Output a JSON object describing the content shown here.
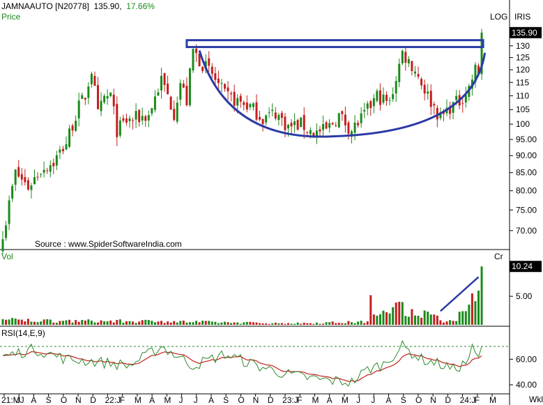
{
  "header": {
    "symbol": "JAMNAAUTO [N20778]",
    "price": "135.90",
    "change": "17.66%",
    "panel_label": "Price"
  },
  "top_right": {
    "log": "LOG",
    "iris": "IRIS"
  },
  "source": "Source : www.SpiderSoftwareIndia.com",
  "colors": {
    "up": "#1a8a1a",
    "down": "#c41e1e",
    "pattern": "#2b3aa6",
    "rsi": "#2a8a2a",
    "rsi_avg": "#c41e1e",
    "last_box": "#000000"
  },
  "price_panel": {
    "label": "Price",
    "last_value": "135.90",
    "scale": "log",
    "y_ticks": [
      "130",
      "125",
      "120",
      "115",
      "110",
      "105",
      "100",
      "95.00",
      "90.00",
      "85.00",
      "80.00",
      "75.00",
      "70.00"
    ]
  },
  "volume_panel": {
    "label": "Vol",
    "unit": "Cr",
    "last_value": "10.24",
    "y_ticks": [
      "5.00"
    ]
  },
  "rsi_panel": {
    "label": "RSI(14,E,9)",
    "y_ticks": [
      "60.00",
      "40.00"
    ]
  },
  "x_axis": {
    "labels": [
      "21:MJ",
      "J",
      "A",
      "S",
      "O",
      "N",
      "D",
      "22:J",
      "F",
      "M",
      "A",
      "M",
      "J",
      "J",
      "A",
      "S",
      "O",
      "N",
      "D",
      "23:J",
      "F",
      "M",
      "A",
      "M",
      "J",
      "J",
      "A",
      "S",
      "O",
      "N",
      "D",
      "24:J",
      "F",
      "M"
    ],
    "unit": "Wkl"
  },
  "chart_data": {
    "type": "candlestick",
    "interval": "weekly",
    "y_scale": "log",
    "close_anchors": [
      [
        0,
        68
      ],
      [
        4,
        85
      ],
      [
        8,
        81
      ],
      [
        12,
        86
      ],
      [
        16,
        88
      ],
      [
        20,
        94
      ],
      [
        24,
        106
      ],
      [
        26,
        110
      ],
      [
        28,
        120
      ],
      [
        30,
        103
      ],
      [
        32,
        109
      ],
      [
        34,
        110
      ],
      [
        36,
        98
      ],
      [
        39,
        101
      ],
      [
        42,
        102
      ],
      [
        46,
        103
      ],
      [
        50,
        116
      ],
      [
        54,
        104
      ],
      [
        56,
        115
      ],
      [
        58,
        108
      ],
      [
        60,
        128
      ],
      [
        62,
        124
      ],
      [
        66,
        118
      ],
      [
        70,
        110
      ],
      [
        74,
        108
      ],
      [
        78,
        106
      ],
      [
        82,
        102
      ],
      [
        86,
        104
      ],
      [
        90,
        99
      ],
      [
        94,
        100
      ],
      [
        98,
        97
      ],
      [
        102,
        98
      ],
      [
        106,
        103
      ],
      [
        110,
        98
      ],
      [
        114,
        103
      ],
      [
        118,
        110
      ],
      [
        122,
        107
      ],
      [
        126,
        127
      ],
      [
        130,
        120
      ],
      [
        134,
        110
      ],
      [
        138,
        102
      ],
      [
        141,
        106
      ],
      [
        144,
        108
      ],
      [
        147,
        113
      ],
      [
        149,
        120
      ],
      [
        150,
        119
      ],
      [
        151,
        135.9
      ]
    ],
    "volume_anchors": [
      [
        0,
        1.0
      ],
      [
        20,
        0.8
      ],
      [
        50,
        0.7
      ],
      [
        90,
        0.3
      ],
      [
        115,
        0.6
      ],
      [
        116,
        5.2
      ],
      [
        118,
        1.6
      ],
      [
        126,
        4.0
      ],
      [
        140,
        0.6
      ],
      [
        146,
        2.4
      ],
      [
        148,
        5.5
      ],
      [
        150,
        6.0
      ],
      [
        151,
        10.24
      ]
    ],
    "rsi_anchors": [
      [
        0,
        62
      ],
      [
        10,
        68
      ],
      [
        20,
        60
      ],
      [
        30,
        58
      ],
      [
        40,
        55
      ],
      [
        50,
        70
      ],
      [
        60,
        55
      ],
      [
        70,
        64
      ],
      [
        80,
        55
      ],
      [
        90,
        48
      ],
      [
        100,
        44
      ],
      [
        110,
        42
      ],
      [
        115,
        52
      ],
      [
        120,
        56
      ],
      [
        126,
        70
      ],
      [
        132,
        60
      ],
      [
        138,
        56
      ],
      [
        142,
        52
      ],
      [
        146,
        57
      ],
      [
        148,
        68
      ],
      [
        150,
        60
      ],
      [
        151,
        70
      ]
    ],
    "rsi_reference": 70,
    "annotations": [
      {
        "type": "resistance_band",
        "y_low": 129.5,
        "y_high": 132.5,
        "from_week": 58,
        "to_week": 151
      },
      {
        "type": "rounding_bottom_arc",
        "left_week": 62,
        "left_y": 128,
        "bottom_week": 104,
        "bottom_y": 96,
        "right_week": 152,
        "right_y": 127
      },
      {
        "type": "volume_trend_line",
        "from_week": 138,
        "from_value": 2.4,
        "to_week": 150,
        "to_value": 8.4
      }
    ]
  }
}
